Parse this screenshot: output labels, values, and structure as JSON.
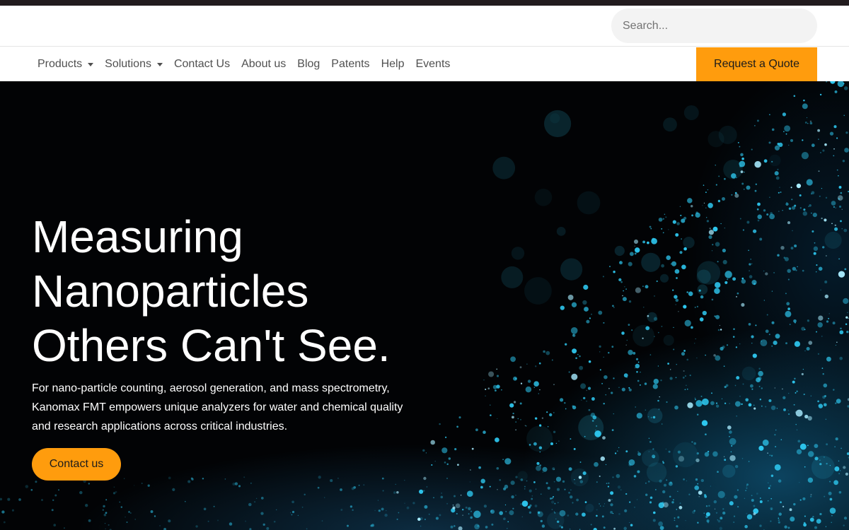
{
  "header": {
    "search_placeholder": "Search..."
  },
  "nav": {
    "items": [
      {
        "label": "Products",
        "dropdown": true
      },
      {
        "label": "Solutions",
        "dropdown": true
      },
      {
        "label": "Contact Us",
        "dropdown": false
      },
      {
        "label": "About us",
        "dropdown": false
      },
      {
        "label": "Blog",
        "dropdown": false
      },
      {
        "label": "Patents",
        "dropdown": false
      },
      {
        "label": "Help",
        "dropdown": false
      },
      {
        "label": "Events",
        "dropdown": false
      }
    ],
    "quote_label": "Request a Quote"
  },
  "hero": {
    "title_lines": [
      "Measuring",
      "Nanoparticles",
      "Others Can't See."
    ],
    "description": "For nano-particle counting, aerosol generation, and mass spectrometry, Kanomax FMT empowers unique analyzers for water and chemical quality and research applications across critical industries.",
    "cta_label": "Contact us"
  },
  "colors": {
    "accent": "#ff9c0d",
    "top_strip": "#221b1e",
    "hero_background": "#020305",
    "particle": "#2ec8f0"
  }
}
